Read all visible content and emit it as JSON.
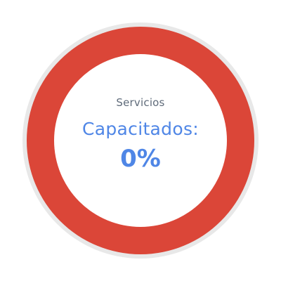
{
  "widget": {
    "title": "Servicios",
    "subtitle": "Capacitados:",
    "value_text": "0%",
    "value": 0
  },
  "colors": {
    "ring": "#db4638",
    "track": "#e8e8e8",
    "title_text": "#5f6b7a",
    "accent_text": "#4f86e6"
  }
}
